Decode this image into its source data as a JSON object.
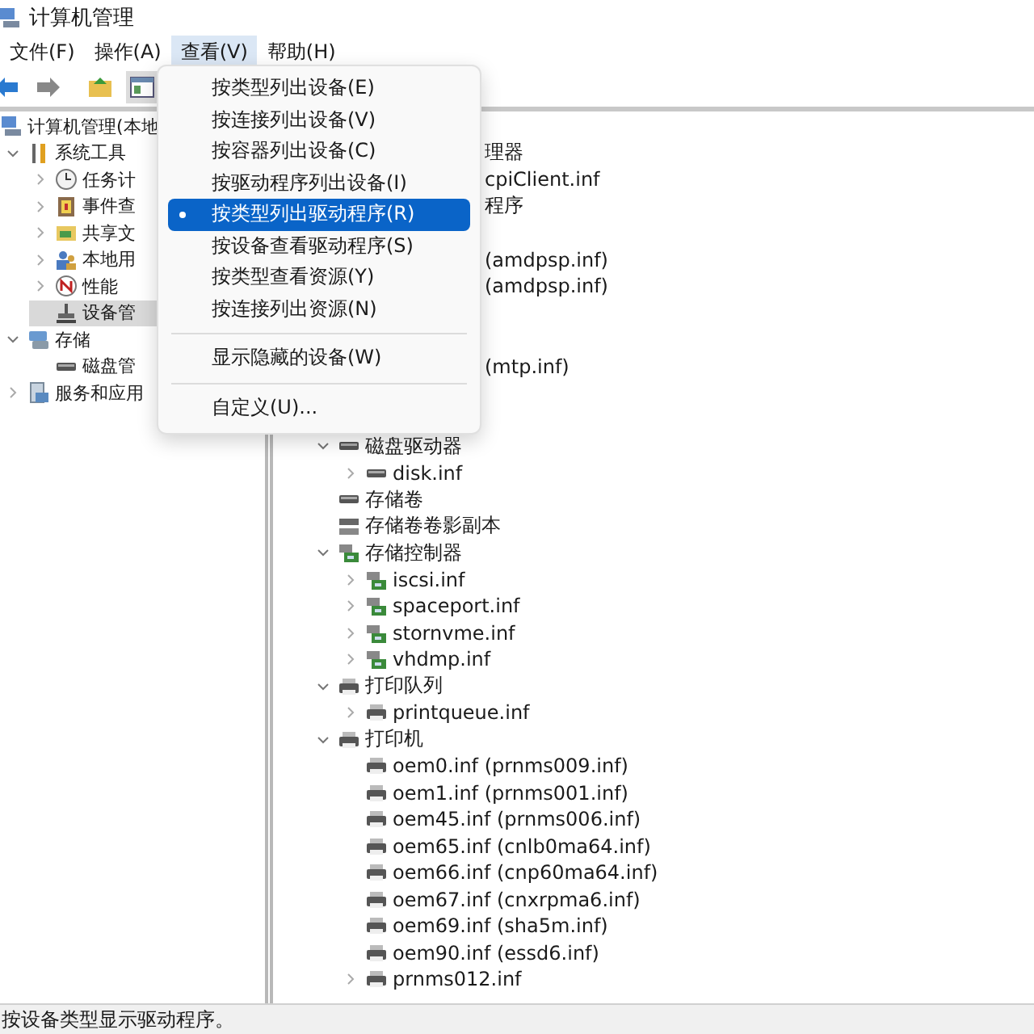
{
  "window": {
    "title": "计算机管理"
  },
  "menu_bar": [
    {
      "label": "文件(F)",
      "selected": false
    },
    {
      "label": "操作(A)",
      "selected": false
    },
    {
      "label": "查看(V)",
      "selected": true
    },
    {
      "label": "帮助(H)",
      "selected": false
    }
  ],
  "left_tree": [
    {
      "label": "计算机管理(本地",
      "kind": "computer",
      "selected": false,
      "children": [
        {
          "label": "系统工具",
          "kind": "tools",
          "expanded": true,
          "selected": false,
          "children": [
            {
              "label": "任务计",
              "kind": "clock",
              "expanded": false,
              "selected": false
            },
            {
              "label": "事件查",
              "kind": "event",
              "expanded": false,
              "selected": false
            },
            {
              "label": "共享文",
              "kind": "share",
              "expanded": false,
              "selected": false
            },
            {
              "label": "本地用",
              "kind": "users",
              "expanded": false,
              "selected": false
            },
            {
              "label": "性能",
              "kind": "perf",
              "expanded": false,
              "selected": false
            },
            {
              "label": "设备管",
              "kind": "device",
              "selected": true
            }
          ]
        },
        {
          "label": "存储",
          "kind": "storage",
          "expanded": true,
          "selected": false,
          "children": [
            {
              "label": "磁盘管",
              "kind": "disk",
              "selected": false
            }
          ]
        },
        {
          "label": "服务和应用",
          "kind": "services",
          "expanded": false,
          "selected": false
        }
      ]
    }
  ],
  "right_fragments": [
    {
      "kind": "covered"
    },
    {
      "kind": "text",
      "label": "理器"
    },
    {
      "kind": "text",
      "label": "cpiClient.inf"
    },
    {
      "kind": "text",
      "label": "程序"
    },
    {
      "kind": "covered"
    },
    {
      "kind": "text",
      "label": "(amdpsp.inf)"
    },
    {
      "kind": "text",
      "label": "(amdpsp.inf)"
    },
    {
      "kind": "covered"
    },
    {
      "kind": "covered"
    },
    {
      "kind": "text",
      "label": "(mtp.inf)"
    },
    {
      "kind": "covered"
    },
    {
      "kind": "covered"
    }
  ],
  "right_tree": [
    {
      "label": "磁盘驱动器",
      "kind": "disk",
      "expanded": true,
      "children": [
        {
          "label": "disk.inf",
          "kind": "disk",
          "expanded": false
        }
      ]
    },
    {
      "label": "存储卷",
      "kind": "disk"
    },
    {
      "label": "存储卷卷影副本",
      "kind": "volume"
    },
    {
      "label": "存储控制器",
      "kind": "controller",
      "expanded": true,
      "children": [
        {
          "label": "iscsi.inf",
          "kind": "controller",
          "expanded": false
        },
        {
          "label": "spaceport.inf",
          "kind": "controller",
          "expanded": false
        },
        {
          "label": "stornvme.inf",
          "kind": "controller",
          "expanded": false
        },
        {
          "label": "vhdmp.inf",
          "kind": "controller",
          "expanded": false
        }
      ]
    },
    {
      "label": "打印队列",
      "kind": "printer",
      "expanded": true,
      "children": [
        {
          "label": "printqueue.inf",
          "kind": "printer",
          "expanded": false
        }
      ]
    },
    {
      "label": "打印机",
      "kind": "printer",
      "expanded": true,
      "children": [
        {
          "label": "oem0.inf (prnms009.inf)",
          "kind": "printer"
        },
        {
          "label": "oem1.inf (prnms001.inf)",
          "kind": "printer"
        },
        {
          "label": "oem45.inf (prnms006.inf)",
          "kind": "printer"
        },
        {
          "label": "oem65.inf (cnlb0ma64.inf)",
          "kind": "printer"
        },
        {
          "label": "oem66.inf (cnp60ma64.inf)",
          "kind": "printer"
        },
        {
          "label": "oem67.inf (cnxrpma6.inf)",
          "kind": "printer"
        },
        {
          "label": "oem69.inf (sha5m.inf)",
          "kind": "printer"
        },
        {
          "label": "oem90.inf (essd6.inf)",
          "kind": "printer"
        },
        {
          "label": "prnms012.inf",
          "kind": "printer",
          "expanded": false
        }
      ]
    }
  ],
  "view_menu": [
    {
      "kind": "item",
      "label": "按类型列出设备(E)",
      "checked": false,
      "highlighted": false
    },
    {
      "kind": "item",
      "label": "按连接列出设备(V)",
      "checked": false,
      "highlighted": false
    },
    {
      "kind": "item",
      "label": "按容器列出设备(C)",
      "checked": false,
      "highlighted": false
    },
    {
      "kind": "item",
      "label": "按驱动程序列出设备(I)",
      "checked": false,
      "highlighted": false
    },
    {
      "kind": "item",
      "label": "按类型列出驱动程序(R)",
      "checked": true,
      "highlighted": true
    },
    {
      "kind": "item",
      "label": "按设备查看驱动程序(S)",
      "checked": false,
      "highlighted": false
    },
    {
      "kind": "item",
      "label": "按类型查看资源(Y)",
      "checked": false,
      "highlighted": false
    },
    {
      "kind": "item",
      "label": "按连接列出资源(N)",
      "checked": false,
      "highlighted": false
    },
    {
      "kind": "separator"
    },
    {
      "kind": "item",
      "label": "显示隐藏的设备(W)",
      "checked": false,
      "highlighted": false
    },
    {
      "kind": "separator"
    },
    {
      "kind": "item",
      "label": "自定义(U)...",
      "checked": false,
      "highlighted": false
    }
  ],
  "status_bar": {
    "text": "按设备类型显示驱动程序。"
  }
}
